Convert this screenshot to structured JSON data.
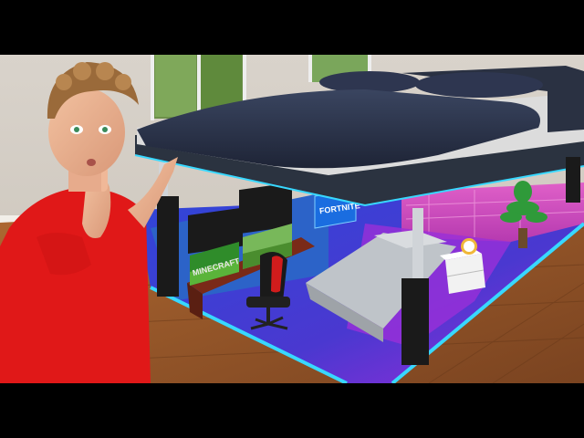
{
  "scene": {
    "monitor_text": "MINECRAFT",
    "sign_text": "FORTNITE"
  },
  "colors": {
    "accent_glow": "#38d8ff",
    "carpet": "#3b3fd6",
    "carpet_purple": "#8a2be2",
    "bed_frame": "#2b3340",
    "duvet": "#2a3246",
    "shirt": "#e01a1a",
    "floor": "#9a5a2a"
  }
}
